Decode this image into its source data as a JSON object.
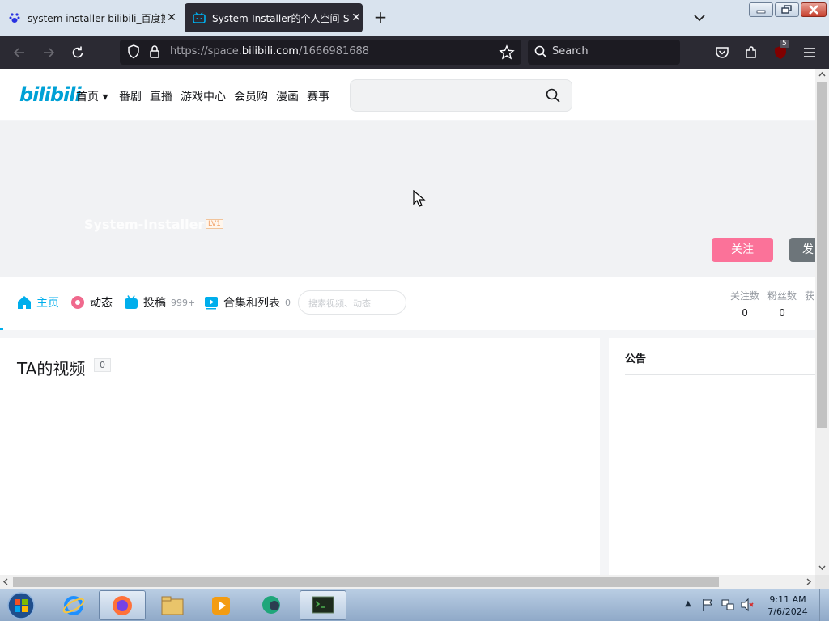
{
  "browser": {
    "tabs": [
      {
        "title": "system installer bilibili_百度搜索",
        "active": false
      },
      {
        "title": "System-Installer的个人空间-Sys",
        "active": true
      }
    ],
    "new_tab": "+",
    "url_prefix": "https://space.",
    "url_host": "bilibili.com",
    "url_path": "/1666981688",
    "search_placeholder": "Search",
    "extension_badge": "5"
  },
  "bili_header": {
    "logo": "bilibili",
    "nav": [
      "首页",
      "番剧",
      "直播",
      "游戏中心",
      "会员购",
      "漫画",
      "赛事"
    ]
  },
  "profile": {
    "username": "System-Installer",
    "level": "LV1",
    "follow_label": "关注",
    "message_label": "发"
  },
  "profile_nav": {
    "items": [
      {
        "label": "主页",
        "count": ""
      },
      {
        "label": "动态",
        "count": ""
      },
      {
        "label": "投稿",
        "count": "999+"
      },
      {
        "label": "合集和列表",
        "count": "0"
      }
    ],
    "search_placeholder": "搜索视频、动态",
    "stats": [
      {
        "label": "关注数",
        "value": "0"
      },
      {
        "label": "粉丝数",
        "value": "0"
      },
      {
        "label": "获",
        "value": ""
      }
    ]
  },
  "videos": {
    "title": "TA的视频",
    "count": "0"
  },
  "notice": {
    "title": "公告"
  },
  "taskbar": {
    "time": "9:11 AM",
    "date": "7/6/2024"
  },
  "colors": {
    "accent": "#00aeec",
    "pink": "#fb7299",
    "browser_dark": "#2b2a33"
  }
}
